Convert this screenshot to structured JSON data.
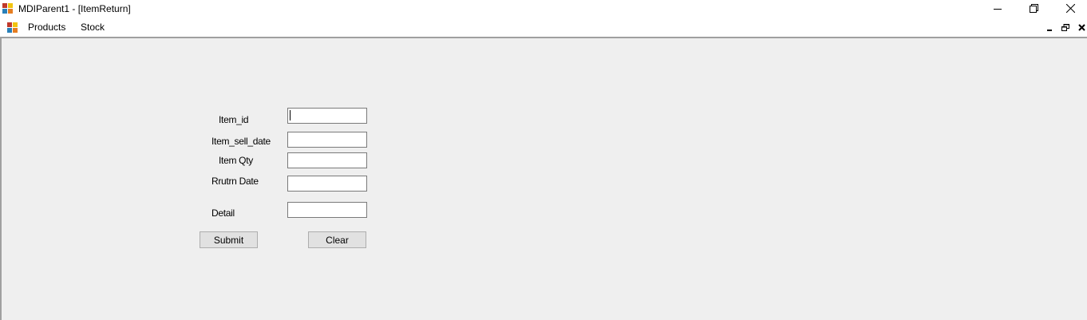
{
  "window": {
    "title": "MDIParent1 - [ItemReturn]",
    "icon": "mdi-app-icon",
    "controls": [
      "minimize-icon",
      "maximize-icon",
      "close-icon"
    ]
  },
  "menu": {
    "items": [
      {
        "label": "Products"
      },
      {
        "label": "Stock"
      }
    ],
    "child_controls": [
      "minimize-icon",
      "restore-icon",
      "close-icon"
    ]
  },
  "form": {
    "fields": [
      {
        "label": "Item_id",
        "value": "",
        "focused": true
      },
      {
        "label": "Item_sell_date",
        "value": ""
      },
      {
        "label": "Item Qty",
        "value": ""
      },
      {
        "label": "Rrutrn Date",
        "value": ""
      },
      {
        "label": "Detail",
        "value": ""
      }
    ],
    "submit_label": "Submit",
    "clear_label": "Clear"
  },
  "colors": {
    "client_background": "#efefef",
    "button_background": "#e1e1e1",
    "button_border": "#adadad",
    "input_border": "#7a7a7a"
  }
}
